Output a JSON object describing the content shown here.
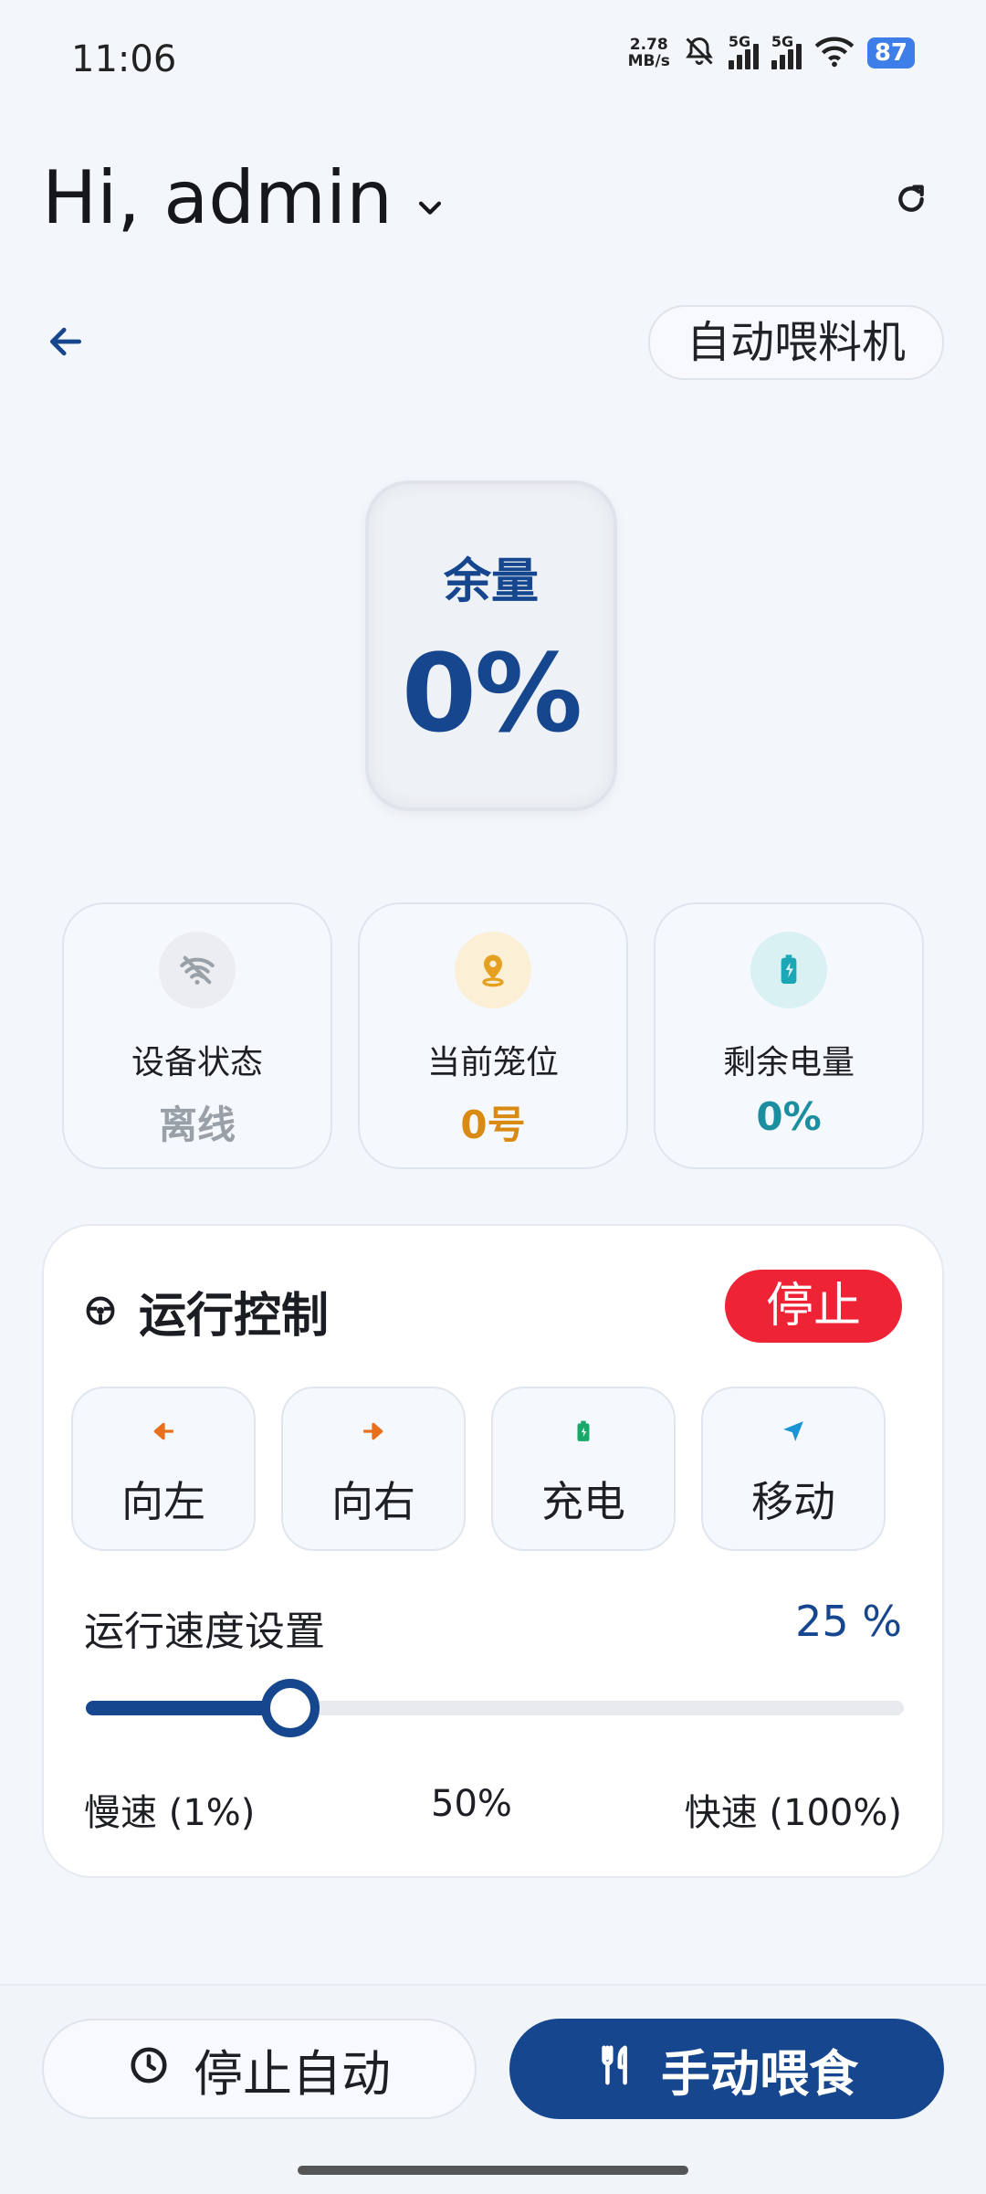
{
  "status_bar": {
    "time": "11:06",
    "net_speed_value": "2.78",
    "net_speed_unit": "MB/s",
    "sim1": "5G",
    "sim2": "5G",
    "battery": "87"
  },
  "header": {
    "greeting": "Hi, admin",
    "device_name": "自动喂料机"
  },
  "gauge": {
    "label": "余量",
    "value": "0%"
  },
  "info_cards": [
    {
      "label": "设备状态",
      "value": "离线",
      "color": "#9aa0a8",
      "icon": "wifi-off-icon"
    },
    {
      "label": "当前笼位",
      "value": "0号",
      "color": "#d98a12",
      "icon": "location-pin-icon"
    },
    {
      "label": "剩余电量",
      "value": "0%",
      "color": "#1b8fa0",
      "icon": "battery-charging-icon"
    }
  ],
  "control": {
    "title": "运行控制",
    "status_button": "停止",
    "buttons": [
      {
        "label": "向左",
        "icon": "arrow-left-icon"
      },
      {
        "label": "向右",
        "icon": "arrow-right-icon"
      },
      {
        "label": "充电",
        "icon": "battery-icon"
      },
      {
        "label": "移动",
        "icon": "navigation-icon"
      }
    ],
    "speed_label": "运行速度设置",
    "speed_value": "25 %",
    "speed_percent": 25,
    "scale_min": "慢速 (1%)",
    "scale_mid": "50%",
    "scale_max": "快速 (100%)"
  },
  "bottom": {
    "stop_auto": "停止自动",
    "manual_feed": "手动喂食"
  },
  "colors": {
    "primary": "#16478e",
    "danger": "#ee2436"
  }
}
